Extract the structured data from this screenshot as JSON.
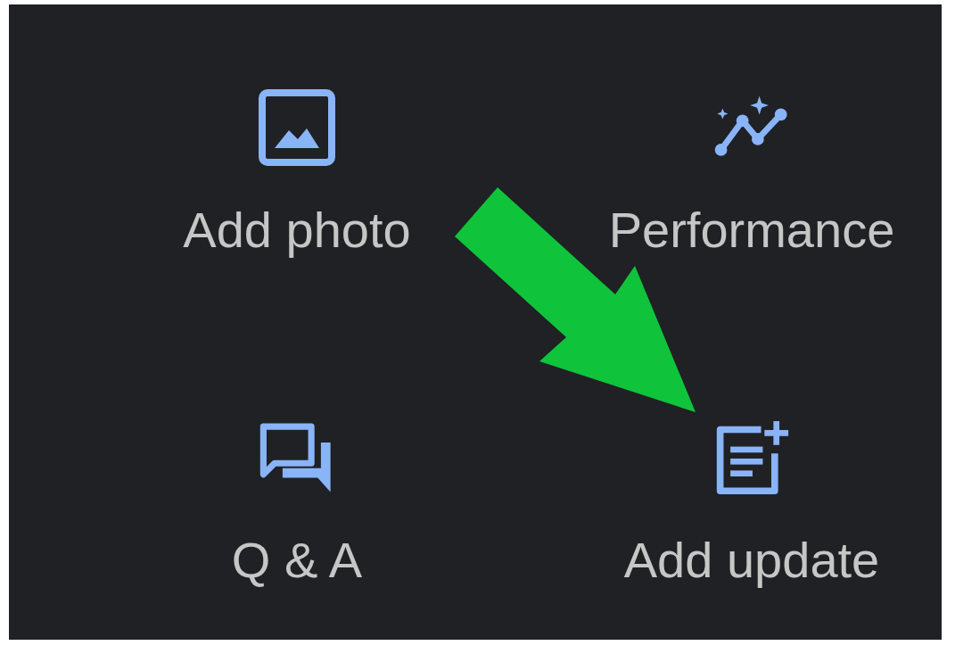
{
  "actions": [
    {
      "label": "Add photo",
      "kind": "photo"
    },
    {
      "label": "Performance",
      "kind": "performance"
    },
    {
      "label": "Q & A",
      "kind": "qa"
    },
    {
      "label": "Add update",
      "kind": "update"
    }
  ]
}
